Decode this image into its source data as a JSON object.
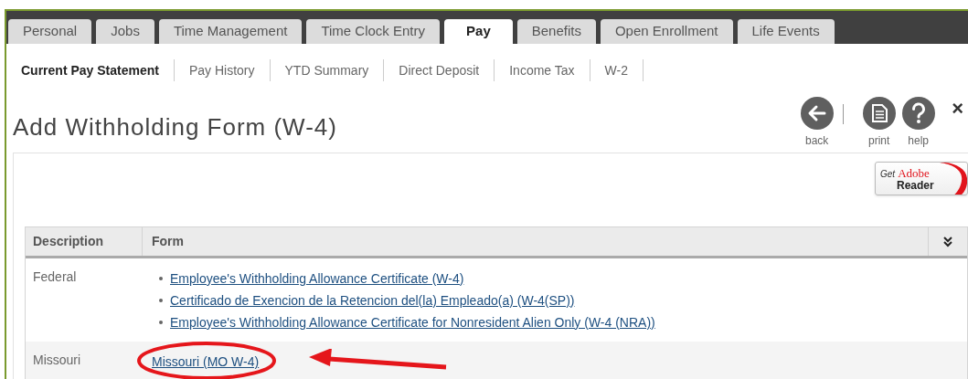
{
  "tabs": [
    {
      "label": "Personal",
      "selected": false
    },
    {
      "label": "Jobs",
      "selected": false
    },
    {
      "label": "Time Management",
      "selected": false
    },
    {
      "label": "Time Clock Entry",
      "selected": false
    },
    {
      "label": "Pay",
      "selected": true
    },
    {
      "label": "Benefits",
      "selected": false
    },
    {
      "label": "Open Enrollment",
      "selected": false
    },
    {
      "label": "Life Events",
      "selected": false
    }
  ],
  "subnav": [
    {
      "label": "Current Pay Statement",
      "selected": true
    },
    {
      "label": "Pay History",
      "selected": false
    },
    {
      "label": "YTD Summary",
      "selected": false
    },
    {
      "label": "Direct Deposit",
      "selected": false
    },
    {
      "label": "Income Tax",
      "selected": false
    },
    {
      "label": "W-2",
      "selected": false
    }
  ],
  "page_title": "Add Withholding Form (W-4)",
  "toolbar": [
    {
      "kind": "back",
      "label": "back"
    },
    {
      "kind": "print",
      "label": "print"
    },
    {
      "kind": "help",
      "label": "help"
    }
  ],
  "adobe_badge": {
    "get": "Get",
    "brand": "Adobe",
    "product": "Reader"
  },
  "table": {
    "columns": [
      "Description",
      "Form"
    ],
    "rows": [
      {
        "description": "Federal",
        "links": [
          "Employee's Withholding Allowance Certificate (W-4)",
          "Certificado de Exencion de la Retencion del(la) Empleado(a) (W-4(SP))",
          "Employee's Withholding Allowance Certificate for Nonresident Alien Only (W-4 (NRA))"
        ]
      },
      {
        "description": "Missouri",
        "links": [
          "Missouri (MO W-4)"
        ],
        "circled": true,
        "arrow": true
      }
    ]
  },
  "close": "×"
}
